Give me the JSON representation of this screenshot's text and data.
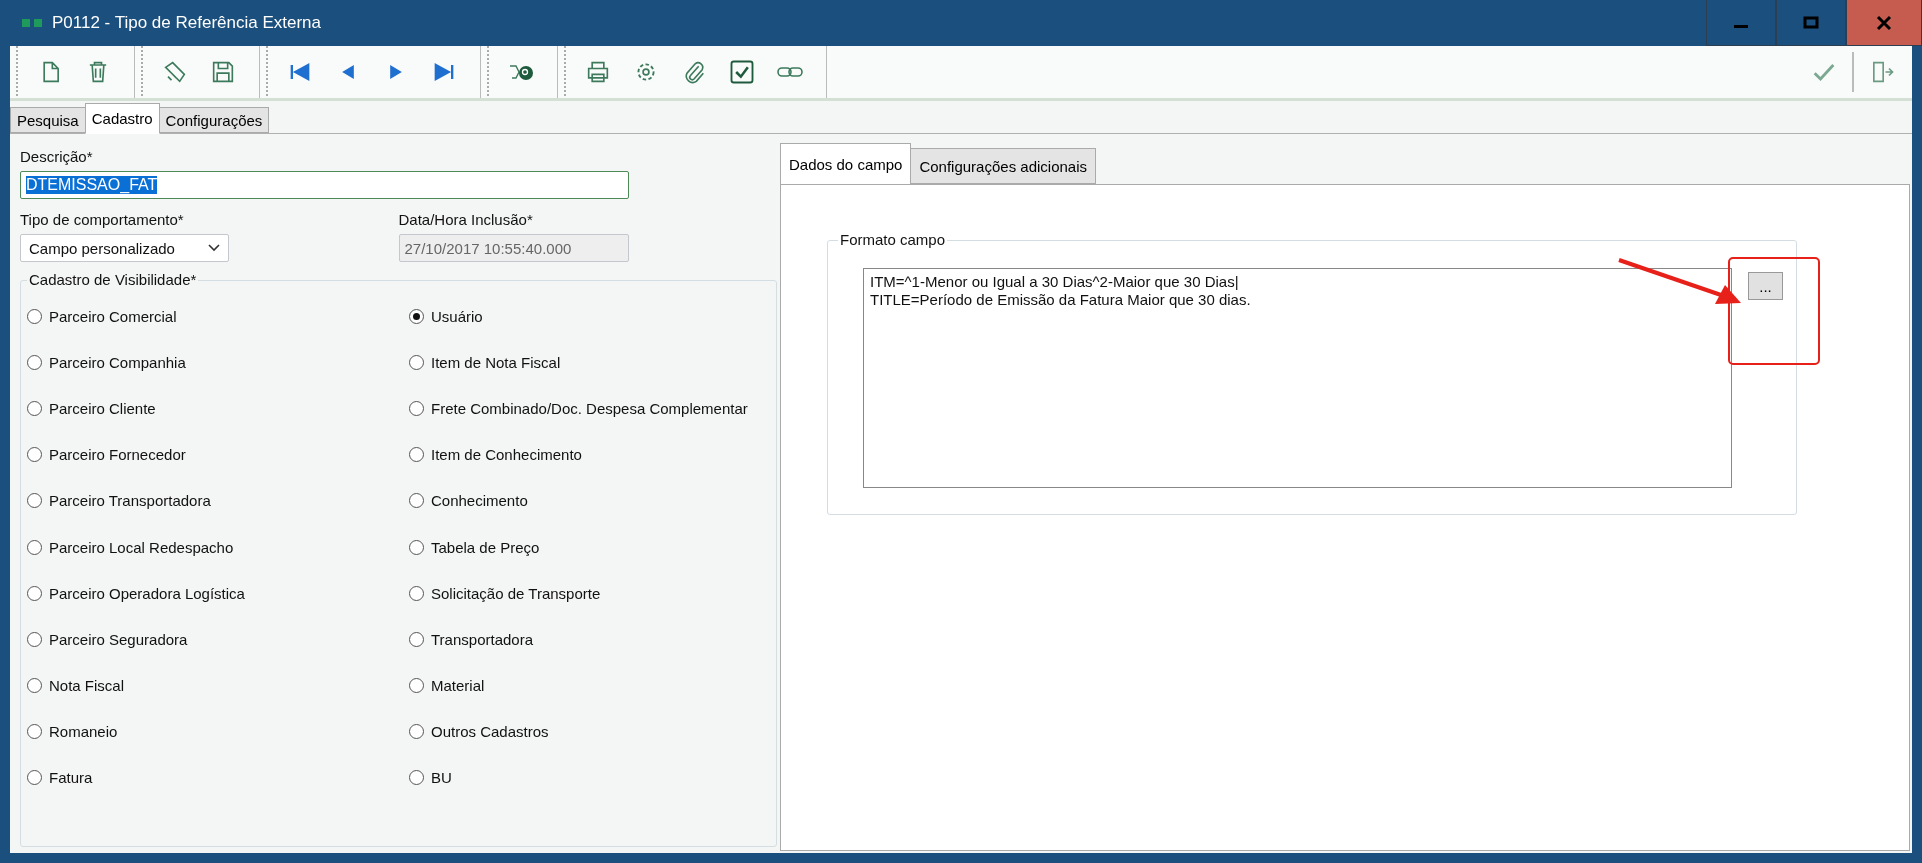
{
  "window": {
    "title": "P0112 - Tipo de Referência Externa"
  },
  "tabs": [
    {
      "label": "Pesquisa",
      "selected": false
    },
    {
      "label": "Cadastro",
      "selected": true
    },
    {
      "label": "Configurações",
      "selected": false
    }
  ],
  "form": {
    "descricao": {
      "label": "Descrição*",
      "value": "DTEMISSAO_FAT",
      "text_selected": true
    },
    "tipo": {
      "label": "Tipo de comportamento*",
      "value": "Campo personalizado"
    },
    "data_hora": {
      "label": "Data/Hora Inclusão*",
      "value": "27/10/2017 10:55:40.000",
      "disabled": true
    },
    "visibilidade": {
      "legend": "Cadastro de Visibilidade*",
      "columns": [
        [
          {
            "label": "Parceiro Comercial",
            "selected": false
          },
          {
            "label": "Parceiro Companhia",
            "selected": false
          },
          {
            "label": "Parceiro Cliente",
            "selected": false
          },
          {
            "label": "Parceiro Fornecedor",
            "selected": false
          },
          {
            "label": "Parceiro Transportadora",
            "selected": false
          },
          {
            "label": "Parceiro Local Redespacho",
            "selected": false
          },
          {
            "label": "Parceiro Operadora Logística",
            "selected": false
          },
          {
            "label": "Parceiro Seguradora",
            "selected": false
          },
          {
            "label": "Nota Fiscal",
            "selected": false
          },
          {
            "label": "Romaneio",
            "selected": false
          },
          {
            "label": "Fatura",
            "selected": false
          }
        ],
        [
          {
            "label": "Usuário",
            "selected": true
          },
          {
            "label": "Item de Nota Fiscal",
            "selected": false
          },
          {
            "label": "Frete Combinado/Doc. Despesa Complementar",
            "selected": false
          },
          {
            "label": "Item de Conhecimento",
            "selected": false
          },
          {
            "label": "Conhecimento",
            "selected": false
          },
          {
            "label": "Tabela de Preço",
            "selected": false
          },
          {
            "label": "Solicitação de Transporte",
            "selected": false
          },
          {
            "label": "Transportadora",
            "selected": false
          },
          {
            "label": "Material",
            "selected": false
          },
          {
            "label": "Outros Cadastros",
            "selected": false
          },
          {
            "label": "BU",
            "selected": false
          }
        ]
      ]
    }
  },
  "detail_tabs": [
    {
      "label": "Dados do campo",
      "selected": true
    },
    {
      "label": "Configurações adicionais",
      "selected": false
    }
  ],
  "formato": {
    "legend": "Formato campo",
    "lines": [
      "ITM=^1-Menor ou Igual a 30 Dias^2-Maior que 30 Dias|",
      "TITLE=Período de Emissão da Fatura Maior que 30 dias."
    ],
    "button": "..."
  }
}
